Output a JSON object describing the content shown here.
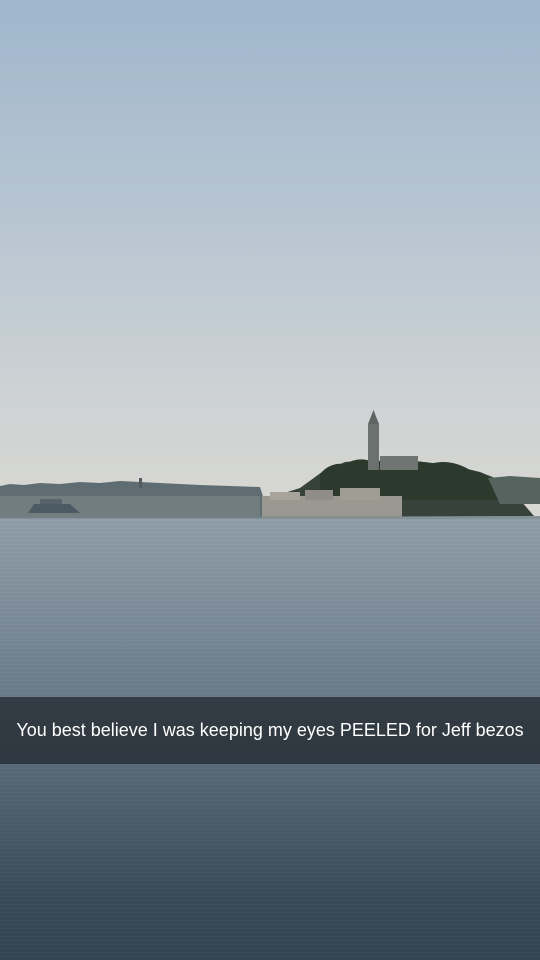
{
  "caption": {
    "text": "You best believe I was keeping my eyes PEELED for Jeff bezos"
  },
  "colors": {
    "sky_top": "#9fb7cc",
    "sky_horizon": "#d9d8d2",
    "water_top": "#8f9ea8",
    "water_bottom": "#334352",
    "caption_bar": "#1e242a",
    "caption_text": "#ffffff"
  }
}
